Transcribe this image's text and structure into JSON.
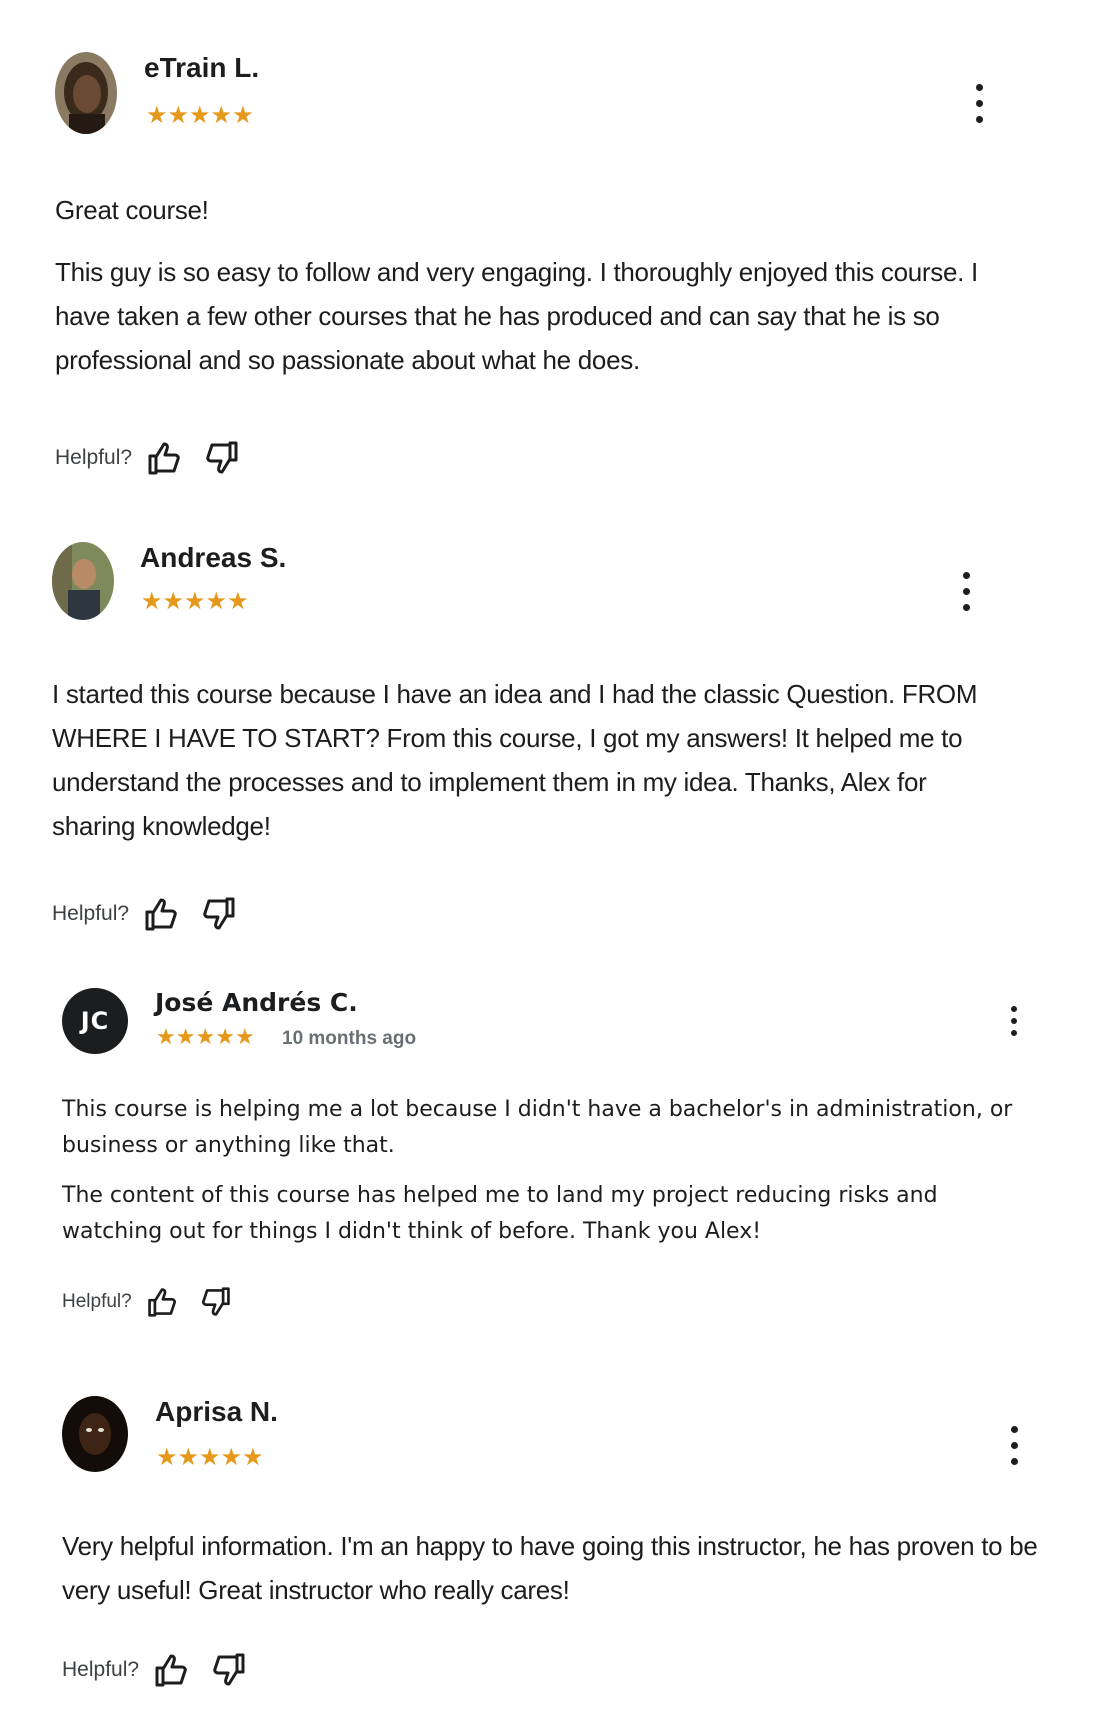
{
  "helpful_label": "Helpful?",
  "star_char": "★",
  "reviews": [
    {
      "name": "eTrain L.",
      "rating": 5,
      "title": "Great course!",
      "body": "This guy is so easy to follow and very engaging. I thoroughly enjoyed this course. I have taken a few other courses that he has produced and can say that he is so professional and so passionate about what he does."
    },
    {
      "name": "Andreas S.",
      "rating": 5,
      "body": "I started this course because I have an idea and I had the classic Question. FROM WHERE I HAVE TO START? From this course, I got my answers! It helped me to understand the processes and to implement them in my idea. Thanks, Alex for sharing knowledge!"
    },
    {
      "name": "José Andrés C.",
      "initials": "JC",
      "rating": 5,
      "time_ago": "10 months ago",
      "body_p1": "This course is helping me a lot because I didn't have a bachelor's in administration, or business or anything like that.",
      "body_p2": "The content of this course has helped me to land my project reducing risks and watching out for things I didn't think of before. Thank you Alex!"
    },
    {
      "name": "Aprisa N.",
      "rating": 5,
      "body": "Very helpful information. I'm an happy to have going this instructor, he has proven to be very useful! Great instructor who really cares!"
    }
  ],
  "colors": {
    "star": "#e59819",
    "text": "#1c1d1f",
    "muted": "#6a6f73",
    "avatar_bg": "#1c1d1f"
  }
}
